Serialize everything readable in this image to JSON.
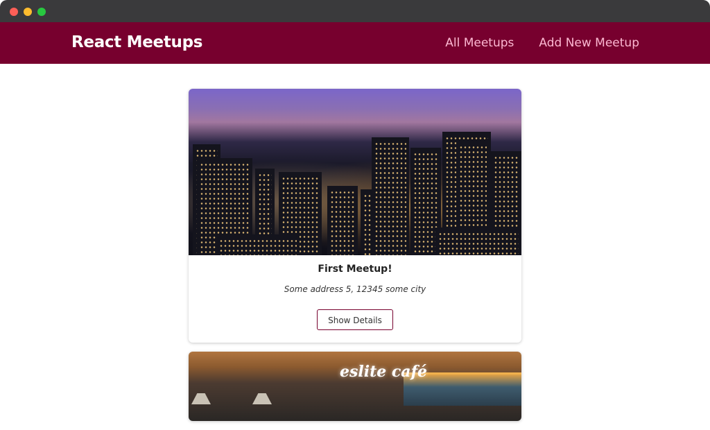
{
  "header": {
    "title": "React Meetups",
    "nav": [
      {
        "label": "All Meetups"
      },
      {
        "label": "Add New Meetup"
      }
    ]
  },
  "meetups": [
    {
      "title": "First Meetup!",
      "address": "Some address 5, 12345 some city",
      "action_label": "Show Details",
      "image_icon": "city-skyline-image"
    },
    {
      "sign_text": "eslite café",
      "image_icon": "cafe-interior-image"
    }
  ],
  "colors": {
    "header_bg": "#77002e",
    "nav_link": "#fcb8d2",
    "button_border": "#77002e"
  }
}
